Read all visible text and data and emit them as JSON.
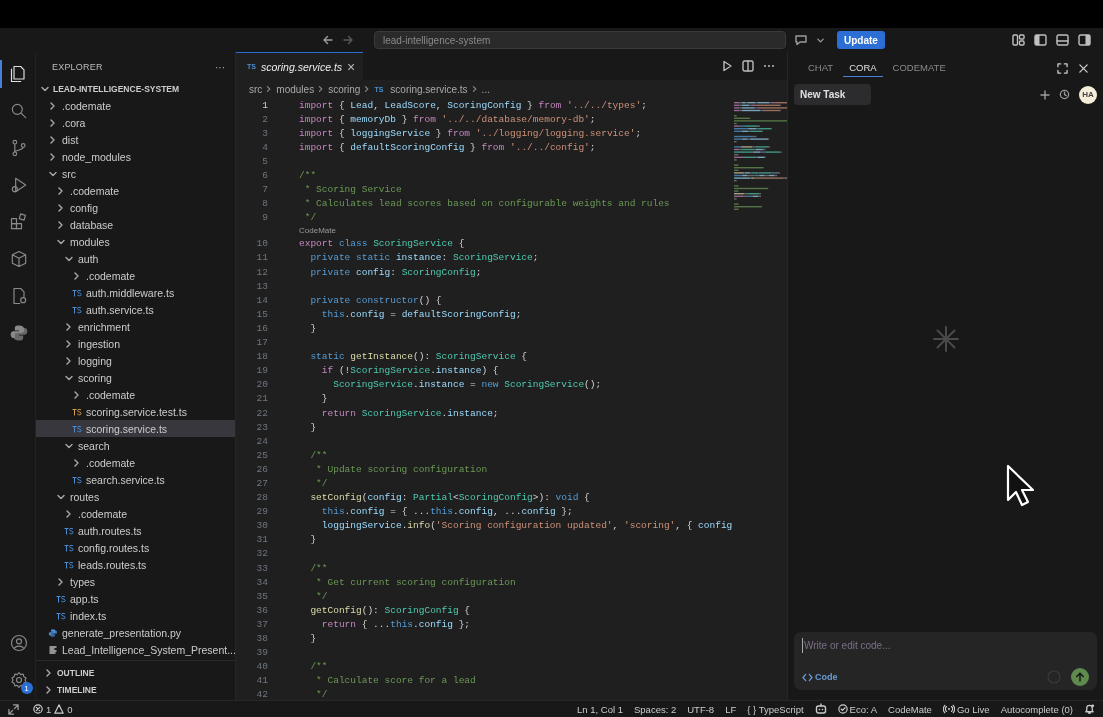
{
  "title_bar": {
    "search": {
      "value": "lead-intelligence-system"
    },
    "update_button": "Update"
  },
  "explorer": {
    "title": "EXPLORER",
    "more": "···",
    "root": {
      "label": "LEAD-INTELLIGENCE-SYSTEM",
      "expanded": true,
      "children": [
        {
          "label": ".codemate",
          "kind": "folder",
          "expanded": false,
          "selected": false
        },
        {
          "label": ".cora",
          "kind": "folder",
          "expanded": false,
          "selected": false
        },
        {
          "label": "dist",
          "kind": "folder",
          "expanded": false,
          "selected": false
        },
        {
          "label": "node_modules",
          "kind": "folder",
          "expanded": false,
          "selected": false
        },
        {
          "label": "src",
          "kind": "folder",
          "expanded": true,
          "selected": false,
          "children": [
            {
              "label": ".codemate",
              "kind": "folder",
              "expanded": false,
              "selected": false
            },
            {
              "label": "config",
              "kind": "folder",
              "expanded": false,
              "selected": false
            },
            {
              "label": "database",
              "kind": "folder",
              "expanded": false,
              "selected": false
            },
            {
              "label": "modules",
              "kind": "folder",
              "expanded": true,
              "selected": false,
              "children": [
                {
                  "label": "auth",
                  "kind": "folder",
                  "expanded": true,
                  "selected": false,
                  "children": [
                    {
                      "label": ".codemate",
                      "kind": "folder",
                      "expanded": false,
                      "selected": false
                    },
                    {
                      "label": "auth.middleware.ts",
                      "kind": "ts",
                      "selected": false
                    },
                    {
                      "label": "auth.service.ts",
                      "kind": "ts",
                      "selected": false
                    }
                  ]
                },
                {
                  "label": "enrichment",
                  "kind": "folder",
                  "expanded": false,
                  "selected": false
                },
                {
                  "label": "ingestion",
                  "kind": "folder",
                  "expanded": false,
                  "selected": false
                },
                {
                  "label": "logging",
                  "kind": "folder",
                  "expanded": false,
                  "selected": false
                },
                {
                  "label": "scoring",
                  "kind": "folder",
                  "expanded": true,
                  "selected": false,
                  "children": [
                    {
                      "label": ".codemate",
                      "kind": "folder",
                      "expanded": false,
                      "selected": false
                    },
                    {
                      "label": "scoring.service.test.ts",
                      "kind": "test",
                      "selected": false
                    },
                    {
                      "label": "scoring.service.ts",
                      "kind": "ts",
                      "selected": true
                    }
                  ]
                },
                {
                  "label": "search",
                  "kind": "folder",
                  "expanded": true,
                  "selected": false,
                  "children": [
                    {
                      "label": ".codemate",
                      "kind": "folder",
                      "expanded": false,
                      "selected": false
                    },
                    {
                      "label": "search.service.ts",
                      "kind": "ts",
                      "selected": false
                    }
                  ]
                }
              ]
            },
            {
              "label": "routes",
              "kind": "folder",
              "expanded": true,
              "selected": false,
              "children": [
                {
                  "label": ".codemate",
                  "kind": "folder",
                  "expanded": false,
                  "selected": false
                },
                {
                  "label": "auth.routes.ts",
                  "kind": "ts",
                  "selected": false
                },
                {
                  "label": "config.routes.ts",
                  "kind": "ts",
                  "selected": false
                },
                {
                  "label": "leads.routes.ts",
                  "kind": "ts",
                  "selected": false
                }
              ]
            },
            {
              "label": "types",
              "kind": "folder",
              "expanded": false,
              "selected": false
            },
            {
              "label": "app.ts",
              "kind": "ts",
              "selected": false
            },
            {
              "label": "index.ts",
              "kind": "ts",
              "selected": false
            }
          ]
        },
        {
          "label": "generate_presentation.py",
          "kind": "py",
          "selected": false
        },
        {
          "label": "Lead_Intelligence_System_Present...",
          "kind": "doc",
          "selected": false
        }
      ]
    },
    "sections": [
      {
        "label": "OUTLINE",
        "expanded": false
      },
      {
        "label": "TIMELINE",
        "expanded": false
      }
    ]
  },
  "activity_bar": {
    "settings_badge": "1"
  },
  "editor": {
    "tab": {
      "icon": "TS",
      "label": "scoring.service.ts",
      "close": "×"
    },
    "breadcrumb": [
      "src",
      "modules",
      "scoring",
      "scoring.service.ts",
      "..."
    ],
    "breadcrumb_icon": "TS",
    "lines": [
      {
        "kind": "code",
        "n": "1",
        "active": true,
        "code": [
          {
            "kind": "kw",
            "text": "import"
          },
          {
            "kind": "pun",
            "text": " { "
          },
          {
            "kind": "var",
            "text": "Lead"
          },
          {
            "kind": "pun",
            "text": ", "
          },
          {
            "kind": "var",
            "text": "LeadScore"
          },
          {
            "kind": "pun",
            "text": ", "
          },
          {
            "kind": "var",
            "text": "ScoringConfig"
          },
          {
            "kind": "pun",
            "text": " } "
          },
          {
            "kind": "kw",
            "text": "from"
          },
          {
            "kind": "str",
            "text": " '../../types'"
          },
          {
            "kind": "pun",
            "text": ";"
          }
        ]
      },
      {
        "kind": "code",
        "n": "2",
        "active": false,
        "code": [
          {
            "kind": "kw",
            "text": "import"
          },
          {
            "kind": "pun",
            "text": " { "
          },
          {
            "kind": "var",
            "text": "memoryDb"
          },
          {
            "kind": "pun",
            "text": " } "
          },
          {
            "kind": "kw",
            "text": "from"
          },
          {
            "kind": "str",
            "text": " '../../database/memory-db'"
          },
          {
            "kind": "pun",
            "text": ";"
          }
        ]
      },
      {
        "kind": "code",
        "n": "3",
        "active": false,
        "code": [
          {
            "kind": "kw",
            "text": "import"
          },
          {
            "kind": "pun",
            "text": " { "
          },
          {
            "kind": "var",
            "text": "loggingService"
          },
          {
            "kind": "pun",
            "text": " } "
          },
          {
            "kind": "kw",
            "text": "from"
          },
          {
            "kind": "str",
            "text": " '../logging/logging.service'"
          },
          {
            "kind": "pun",
            "text": ";"
          }
        ]
      },
      {
        "kind": "code",
        "n": "4",
        "active": false,
        "code": [
          {
            "kind": "kw",
            "text": "import"
          },
          {
            "kind": "pun",
            "text": " { "
          },
          {
            "kind": "var",
            "text": "defaultScoringConfig"
          },
          {
            "kind": "pun",
            "text": " } "
          },
          {
            "kind": "kw",
            "text": "from"
          },
          {
            "kind": "str",
            "text": " '../../config'"
          },
          {
            "kind": "pun",
            "text": ";"
          }
        ]
      },
      {
        "kind": "code",
        "n": "5",
        "active": false
      },
      {
        "kind": "code",
        "n": "6",
        "active": false,
        "code": [
          {
            "kind": "cmt",
            "text": "/**"
          }
        ]
      },
      {
        "kind": "code",
        "n": "7",
        "active": false,
        "code": [
          {
            "kind": "cmt",
            "text": " * Scoring Service"
          }
        ]
      },
      {
        "kind": "code",
        "n": "8",
        "active": false,
        "code": [
          {
            "kind": "cmt",
            "text": " * Calculates lead scores based on configurable weights and rules"
          }
        ]
      },
      {
        "kind": "code",
        "n": "9",
        "active": false,
        "code": [
          {
            "kind": "cmt",
            "text": " */"
          }
        ]
      },
      {
        "kind": "codelens",
        "text": "CodeMate"
      },
      {
        "kind": "code",
        "n": "10",
        "active": false,
        "code": [
          {
            "kind": "kw",
            "text": "export"
          },
          {
            "kind": "st",
            "text": " class"
          },
          {
            "kind": "type",
            "text": " ScoringService"
          },
          {
            "kind": "pun",
            "text": " {"
          }
        ]
      },
      {
        "kind": "code",
        "n": "11",
        "active": false,
        "code": [
          {
            "kind": "st",
            "text": "  private static"
          },
          {
            "kind": "var",
            "text": " instance"
          },
          {
            "kind": "pun",
            "text": ": "
          },
          {
            "kind": "type",
            "text": "ScoringService"
          },
          {
            "kind": "pun",
            "text": ";"
          }
        ]
      },
      {
        "kind": "code",
        "n": "12",
        "active": false,
        "code": [
          {
            "kind": "st",
            "text": "  private"
          },
          {
            "kind": "var",
            "text": " config"
          },
          {
            "kind": "pun",
            "text": ": "
          },
          {
            "kind": "type",
            "text": "ScoringConfig"
          },
          {
            "kind": "pun",
            "text": ";"
          }
        ]
      },
      {
        "kind": "code",
        "n": "13",
        "active": false
      },
      {
        "kind": "code",
        "n": "14",
        "active": false,
        "code": [
          {
            "kind": "st",
            "text": "  private constructor"
          },
          {
            "kind": "pun",
            "text": "() {"
          }
        ]
      },
      {
        "kind": "code",
        "n": "15",
        "active": false,
        "code": [
          {
            "kind": "st",
            "text": "    this"
          },
          {
            "kind": "pun",
            "text": "."
          },
          {
            "kind": "var",
            "text": "config"
          },
          {
            "kind": "pun",
            "text": " = "
          },
          {
            "kind": "var",
            "text": "defaultScoringConfig"
          },
          {
            "kind": "pun",
            "text": ";"
          }
        ]
      },
      {
        "kind": "code",
        "n": "16",
        "active": false,
        "code": [
          {
            "kind": "pun",
            "text": "  }"
          }
        ]
      },
      {
        "kind": "code",
        "n": "17",
        "active": false
      },
      {
        "kind": "code",
        "n": "18",
        "active": false,
        "code": [
          {
            "kind": "st",
            "text": "  static"
          },
          {
            "kind": "fn",
            "text": " getInstance"
          },
          {
            "kind": "pun",
            "text": "(): "
          },
          {
            "kind": "type",
            "text": "ScoringService"
          },
          {
            "kind": "pun",
            "text": " {"
          }
        ]
      },
      {
        "kind": "code",
        "n": "19",
        "active": false,
        "code": [
          {
            "kind": "kw",
            "text": "    if"
          },
          {
            "kind": "pun",
            "text": " (!"
          },
          {
            "kind": "type",
            "text": "ScoringService"
          },
          {
            "kind": "pun",
            "text": "."
          },
          {
            "kind": "var",
            "text": "instance"
          },
          {
            "kind": "pun",
            "text": ") {"
          }
        ]
      },
      {
        "kind": "code",
        "n": "20",
        "active": false,
        "code": [
          {
            "kind": "type",
            "text": "      ScoringService"
          },
          {
            "kind": "pun",
            "text": "."
          },
          {
            "kind": "var",
            "text": "instance"
          },
          {
            "kind": "pun",
            "text": " = "
          },
          {
            "kind": "st",
            "text": "new"
          },
          {
            "kind": "type",
            "text": " ScoringService"
          },
          {
            "kind": "pun",
            "text": "();"
          }
        ]
      },
      {
        "kind": "code",
        "n": "21",
        "active": false,
        "code": [
          {
            "kind": "pun",
            "text": "    }"
          }
        ]
      },
      {
        "kind": "code",
        "n": "22",
        "active": false,
        "code": [
          {
            "kind": "kw",
            "text": "    return"
          },
          {
            "kind": "type",
            "text": " ScoringService"
          },
          {
            "kind": "pun",
            "text": "."
          },
          {
            "kind": "var",
            "text": "instance"
          },
          {
            "kind": "pun",
            "text": ";"
          }
        ]
      },
      {
        "kind": "code",
        "n": "23",
        "active": false,
        "code": [
          {
            "kind": "pun",
            "text": "  }"
          }
        ]
      },
      {
        "kind": "code",
        "n": "24",
        "active": false
      },
      {
        "kind": "code",
        "n": "25",
        "active": false,
        "code": [
          {
            "kind": "cmt",
            "text": "  /**"
          }
        ]
      },
      {
        "kind": "code",
        "n": "26",
        "active": false,
        "code": [
          {
            "kind": "cmt",
            "text": "   * Update scoring configuration"
          }
        ]
      },
      {
        "kind": "code",
        "n": "27",
        "active": false,
        "code": [
          {
            "kind": "cmt",
            "text": "   */"
          }
        ]
      },
      {
        "kind": "code",
        "n": "28",
        "active": false,
        "code": [
          {
            "kind": "fn",
            "text": "  setConfig"
          },
          {
            "kind": "pun",
            "text": "("
          },
          {
            "kind": "var",
            "text": "config"
          },
          {
            "kind": "pun",
            "text": ": "
          },
          {
            "kind": "type",
            "text": "Partial"
          },
          {
            "kind": "pun",
            "text": "<"
          },
          {
            "kind": "type",
            "text": "ScoringConfig"
          },
          {
            "kind": "pun",
            "text": ">): "
          },
          {
            "kind": "st",
            "text": "void"
          },
          {
            "kind": "pun",
            "text": " {"
          }
        ]
      },
      {
        "kind": "code",
        "n": "29",
        "active": false,
        "code": [
          {
            "kind": "st",
            "text": "    this"
          },
          {
            "kind": "pun",
            "text": "."
          },
          {
            "kind": "var",
            "text": "config"
          },
          {
            "kind": "pun",
            "text": " = { ..."
          },
          {
            "kind": "st",
            "text": "this"
          },
          {
            "kind": "pun",
            "text": "."
          },
          {
            "kind": "var",
            "text": "config"
          },
          {
            "kind": "pun",
            "text": ", ..."
          },
          {
            "kind": "var",
            "text": "config"
          },
          {
            "kind": "pun",
            "text": " };"
          }
        ]
      },
      {
        "kind": "code",
        "n": "30",
        "active": false,
        "code": [
          {
            "kind": "var",
            "text": "    loggingService"
          },
          {
            "kind": "pun",
            "text": "."
          },
          {
            "kind": "fn",
            "text": "info"
          },
          {
            "kind": "pun",
            "text": "("
          },
          {
            "kind": "str",
            "text": "'Scoring configuration updated'"
          },
          {
            "kind": "pun",
            "text": ", "
          },
          {
            "kind": "str",
            "text": "'scoring'"
          },
          {
            "kind": "pun",
            "text": ", { "
          },
          {
            "kind": "var",
            "text": "config"
          }
        ]
      },
      {
        "kind": "code",
        "n": "31",
        "active": false,
        "code": [
          {
            "kind": "pun",
            "text": "  }"
          }
        ]
      },
      {
        "kind": "code",
        "n": "32",
        "active": false
      },
      {
        "kind": "code",
        "n": "33",
        "active": false,
        "code": [
          {
            "kind": "cmt",
            "text": "  /**"
          }
        ]
      },
      {
        "kind": "code",
        "n": "34",
        "active": false,
        "code": [
          {
            "kind": "cmt",
            "text": "   * Get current scoring configuration"
          }
        ]
      },
      {
        "kind": "code",
        "n": "35",
        "active": false,
        "code": [
          {
            "kind": "cmt",
            "text": "   */"
          }
        ]
      },
      {
        "kind": "code",
        "n": "36",
        "active": false,
        "code": [
          {
            "kind": "fn",
            "text": "  getConfig"
          },
          {
            "kind": "pun",
            "text": "(): "
          },
          {
            "kind": "type",
            "text": "ScoringConfig"
          },
          {
            "kind": "pun",
            "text": " {"
          }
        ]
      },
      {
        "kind": "code",
        "n": "37",
        "active": false,
        "code": [
          {
            "kind": "kw",
            "text": "    return"
          },
          {
            "kind": "pun",
            "text": " { ..."
          },
          {
            "kind": "st",
            "text": "this"
          },
          {
            "kind": "pun",
            "text": "."
          },
          {
            "kind": "var",
            "text": "config"
          },
          {
            "kind": "pun",
            "text": " };"
          }
        ]
      },
      {
        "kind": "code",
        "n": "38",
        "active": false,
        "code": [
          {
            "kind": "pun",
            "text": "  }"
          }
        ]
      },
      {
        "kind": "code",
        "n": "39",
        "active": false
      },
      {
        "kind": "code",
        "n": "40",
        "active": false,
        "code": [
          {
            "kind": "cmt",
            "text": "  /**"
          }
        ]
      },
      {
        "kind": "code",
        "n": "41",
        "active": false,
        "code": [
          {
            "kind": "cmt",
            "text": "   * Calculate score for a lead"
          }
        ]
      },
      {
        "kind": "code",
        "n": "42",
        "active": false,
        "code": [
          {
            "kind": "cmt",
            "text": "   */"
          }
        ]
      }
    ]
  },
  "assistant": {
    "tabs": [
      {
        "label": "CHAT",
        "selected": false
      },
      {
        "label": "CORA",
        "selected": true
      },
      {
        "label": "CODEMATE",
        "selected": false
      }
    ],
    "new_task": "New Task",
    "avatar": "HA",
    "input": {
      "placeholder": "Write or edit code...",
      "mode": "Code"
    }
  },
  "status_bar": {
    "errors": "1",
    "warnings": "0",
    "items": [
      {
        "kind": "text",
        "text": "Ln 1, Col 1"
      },
      {
        "kind": "text",
        "text": "Spaces: 2"
      },
      {
        "kind": "text",
        "text": "UTF-8"
      },
      {
        "kind": "text",
        "text": "LF"
      },
      {
        "kind": "text",
        "text": "{ } TypeScript"
      },
      {
        "kind": "robot"
      },
      {
        "kind": "eco",
        "text": "Eco: A"
      },
      {
        "kind": "text",
        "text": "CodeMate"
      },
      {
        "kind": "live",
        "text": "Go Live"
      },
      {
        "kind": "text",
        "text": "Autocomplete (0)"
      },
      {
        "kind": "bell"
      }
    ]
  }
}
